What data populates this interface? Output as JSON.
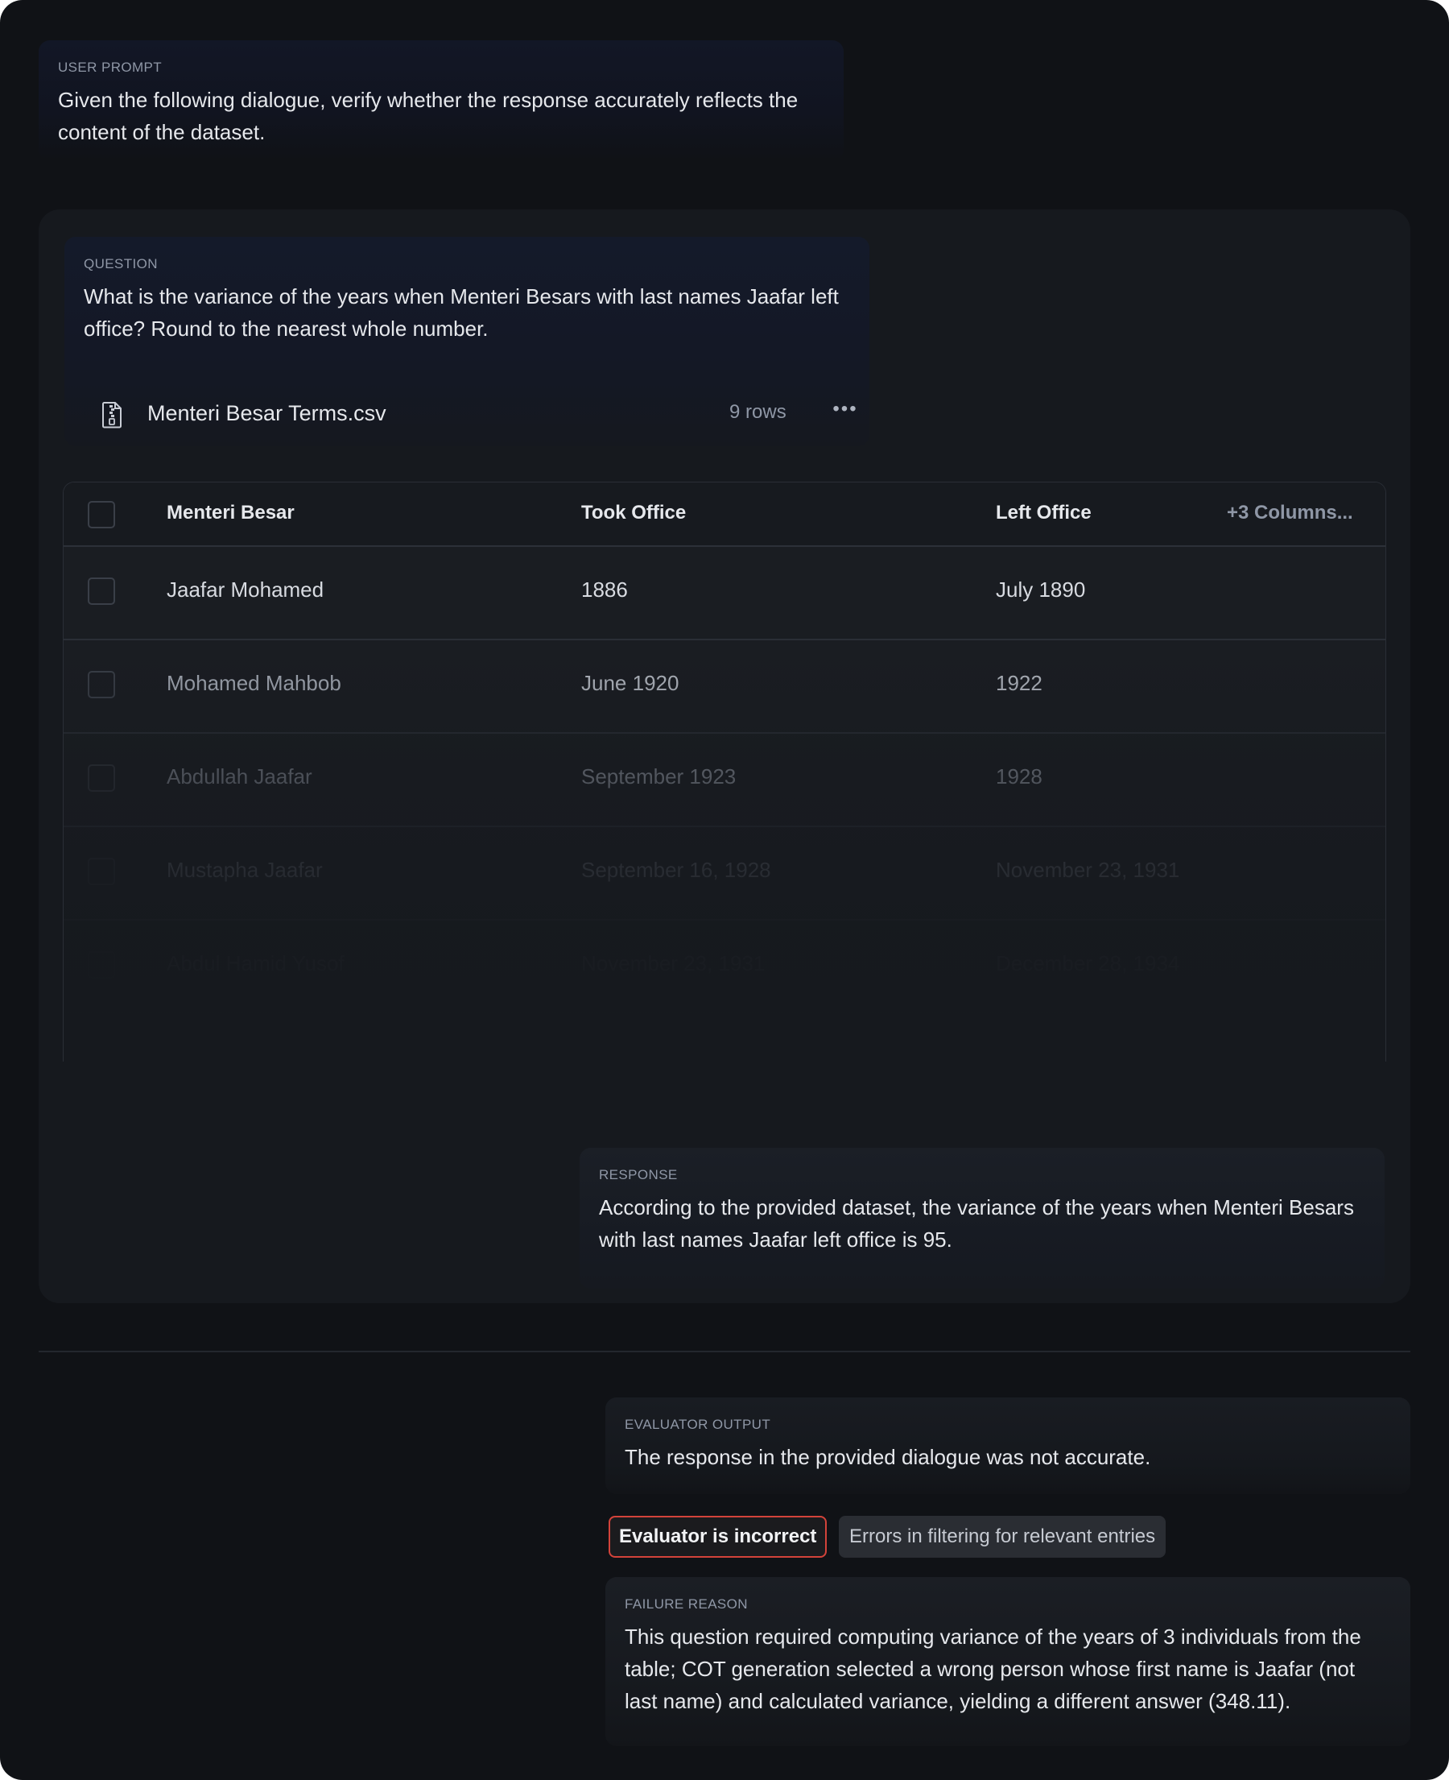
{
  "user_prompt": {
    "label": "USER PROMPT",
    "text": "Given the following dialogue, verify whether the response accurately reflects the content of the dataset."
  },
  "question": {
    "label": "QUESTION",
    "text": "What is the variance of the years when Menteri Besars with last names Jaafar left office? Round to the nearest whole number."
  },
  "file": {
    "icon": "zip-file-icon",
    "name": "Menteri Besar Terms.csv",
    "rows": "9 rows",
    "more": "•••"
  },
  "table": {
    "columns": [
      "Menteri Besar",
      "Took Office",
      "Left Office"
    ],
    "more_columns": "+3 Columns...",
    "rows": [
      [
        "Jaafar Mohamed",
        "1886",
        "July 1890"
      ],
      [
        "Mohamed Mahbob",
        "June 1920",
        "1922"
      ],
      [
        "Abdullah Jaafar",
        "September 1923",
        "1928"
      ],
      [
        "Mustapha Jaafar",
        "September 16, 1928",
        "November 23, 1931"
      ],
      [
        "Abdul Hamid Yusof",
        "November 23, 1931",
        "December 28, 1934"
      ]
    ]
  },
  "response": {
    "label": "RESPONSE",
    "text": "According to the provided dataset, the variance of the years when Menteri Besars with last names Jaafar left office is 95."
  },
  "evaluator": {
    "label": "EVALUATOR OUTPUT",
    "text": "The response in the provided dialogue was not accurate."
  },
  "tags": {
    "incorrect": "Evaluator is incorrect",
    "error": "Errors in filtering for relevant entries"
  },
  "failure": {
    "label": "FAILURE REASON",
    "text": "This question required computing variance of the years of 3 individuals from the table; COT generation selected a wrong person whose first name is Jaafar (not last name) and calculated variance, yielding a different answer (348.11)."
  },
  "colors": {
    "background": "#101216",
    "card": "#16191e",
    "accent_red": "#d3433a",
    "text": "#e6e8ec",
    "muted": "#8f97a6"
  }
}
